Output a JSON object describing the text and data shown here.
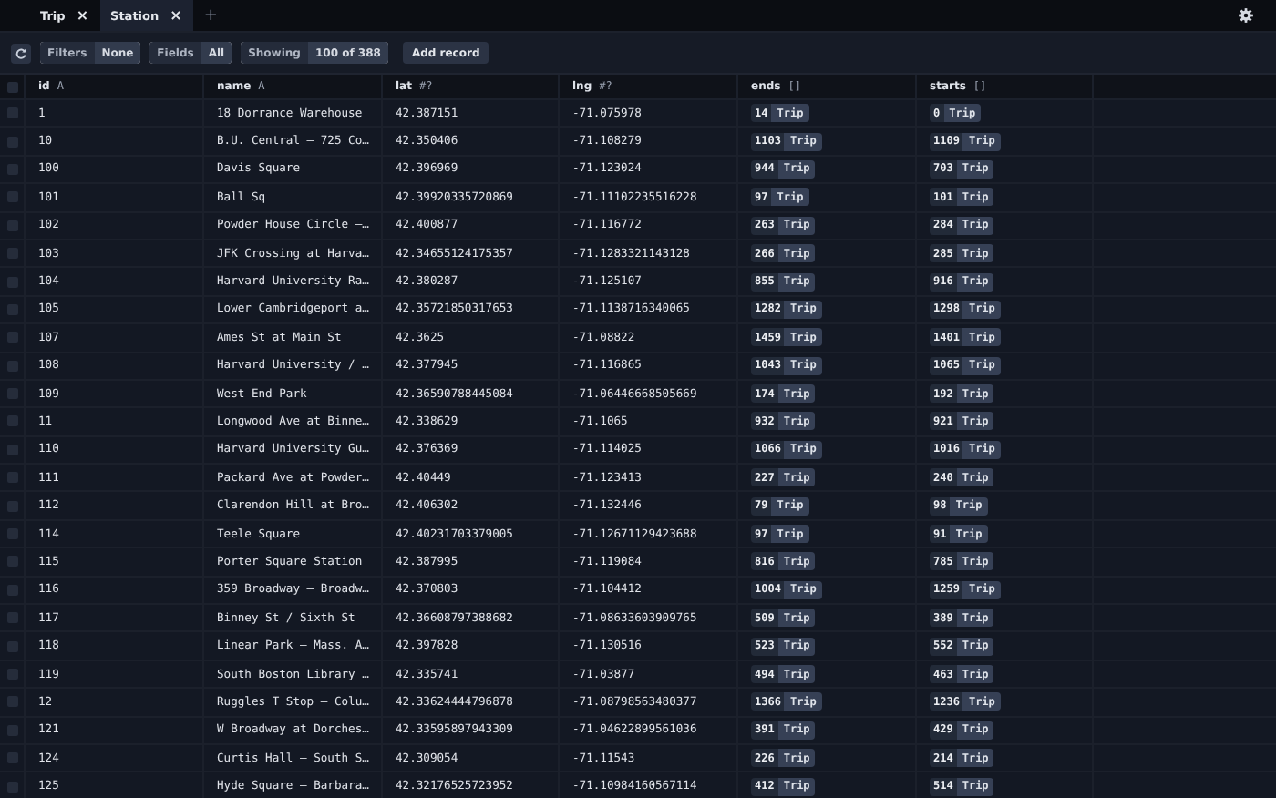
{
  "tabs": [
    {
      "label": "Trip",
      "close": "×",
      "selected": false
    },
    {
      "label": "Station",
      "close": "×",
      "selected": true
    }
  ],
  "new_tab": "+",
  "toolbar": {
    "filters": {
      "label": "Filters",
      "value": "None"
    },
    "fields": {
      "label": "Fields",
      "value": "All"
    },
    "showing": {
      "label": "Showing",
      "value": "100 of 388"
    },
    "add_record": "Add record"
  },
  "table": {
    "columns": [
      {
        "label": "id",
        "type": "A"
      },
      {
        "label": "name",
        "type": "A"
      },
      {
        "label": "lat",
        "type": "#?"
      },
      {
        "label": "lng",
        "type": "#?"
      },
      {
        "label": "ends",
        "type": "[]"
      },
      {
        "label": "starts",
        "type": "[]"
      }
    ],
    "header_checked": false,
    "rows": [
      {
        "checked": false,
        "id": "1",
        "name": "18 Dorrance Warehouse",
        "lat": "42.387151",
        "lng": "-71.075978",
        "ends": {
          "count": "14",
          "label": "Trip"
        },
        "starts": {
          "count": "0",
          "label": "Trip"
        }
      },
      {
        "checked": false,
        "id": "10",
        "name": "B.U. Central – 725 Co…",
        "lat": "42.350406",
        "lng": "-71.108279",
        "ends": {
          "count": "1103",
          "label": "Trip"
        },
        "starts": {
          "count": "1109",
          "label": "Trip"
        }
      },
      {
        "checked": false,
        "id": "100",
        "name": "Davis Square",
        "lat": "42.396969",
        "lng": "-71.123024",
        "ends": {
          "count": "944",
          "label": "Trip"
        },
        "starts": {
          "count": "703",
          "label": "Trip"
        }
      },
      {
        "checked": false,
        "id": "101",
        "name": "Ball Sq",
        "lat": "42.39920335720869",
        "lng": "-71.11102235516228",
        "ends": {
          "count": "97",
          "label": "Trip"
        },
        "starts": {
          "count": "101",
          "label": "Trip"
        }
      },
      {
        "checked": false,
        "id": "102",
        "name": "Powder House Circle –…",
        "lat": "42.400877",
        "lng": "-71.116772",
        "ends": {
          "count": "263",
          "label": "Trip"
        },
        "starts": {
          "count": "284",
          "label": "Trip"
        }
      },
      {
        "checked": false,
        "id": "103",
        "name": "JFK Crossing at Harva…",
        "lat": "42.34655124175357",
        "lng": "-71.1283321143128",
        "ends": {
          "count": "266",
          "label": "Trip"
        },
        "starts": {
          "count": "285",
          "label": "Trip"
        }
      },
      {
        "checked": false,
        "id": "104",
        "name": "Harvard University Ra…",
        "lat": "42.380287",
        "lng": "-71.125107",
        "ends": {
          "count": "855",
          "label": "Trip"
        },
        "starts": {
          "count": "916",
          "label": "Trip"
        }
      },
      {
        "checked": false,
        "id": "105",
        "name": "Lower Cambridgeport a…",
        "lat": "42.35721850317653",
        "lng": "-71.1138716340065",
        "ends": {
          "count": "1282",
          "label": "Trip"
        },
        "starts": {
          "count": "1298",
          "label": "Trip"
        }
      },
      {
        "checked": false,
        "id": "107",
        "name": "Ames St at Main St",
        "lat": "42.3625",
        "lng": "-71.08822",
        "ends": {
          "count": "1459",
          "label": "Trip"
        },
        "starts": {
          "count": "1401",
          "label": "Trip"
        }
      },
      {
        "checked": false,
        "id": "108",
        "name": "Harvard University / …",
        "lat": "42.377945",
        "lng": "-71.116865",
        "ends": {
          "count": "1043",
          "label": "Trip"
        },
        "starts": {
          "count": "1065",
          "label": "Trip"
        }
      },
      {
        "checked": false,
        "id": "109",
        "name": "West End Park",
        "lat": "42.36590788445084",
        "lng": "-71.06446668505669",
        "ends": {
          "count": "174",
          "label": "Trip"
        },
        "starts": {
          "count": "192",
          "label": "Trip"
        }
      },
      {
        "checked": false,
        "id": "11",
        "name": "Longwood Ave at Binne…",
        "lat": "42.338629",
        "lng": "-71.1065",
        "ends": {
          "count": "932",
          "label": "Trip"
        },
        "starts": {
          "count": "921",
          "label": "Trip"
        }
      },
      {
        "checked": false,
        "id": "110",
        "name": "Harvard University Gu…",
        "lat": "42.376369",
        "lng": "-71.114025",
        "ends": {
          "count": "1066",
          "label": "Trip"
        },
        "starts": {
          "count": "1016",
          "label": "Trip"
        }
      },
      {
        "checked": false,
        "id": "111",
        "name": "Packard Ave at Powder…",
        "lat": "42.40449",
        "lng": "-71.123413",
        "ends": {
          "count": "227",
          "label": "Trip"
        },
        "starts": {
          "count": "240",
          "label": "Trip"
        }
      },
      {
        "checked": false,
        "id": "112",
        "name": "Clarendon Hill at Bro…",
        "lat": "42.406302",
        "lng": "-71.132446",
        "ends": {
          "count": "79",
          "label": "Trip"
        },
        "starts": {
          "count": "98",
          "label": "Trip"
        }
      },
      {
        "checked": false,
        "id": "114",
        "name": "Teele Square",
        "lat": "42.40231703379005",
        "lng": "-71.12671129423688",
        "ends": {
          "count": "97",
          "label": "Trip"
        },
        "starts": {
          "count": "91",
          "label": "Trip"
        }
      },
      {
        "checked": false,
        "id": "115",
        "name": "Porter Square Station",
        "lat": "42.387995",
        "lng": "-71.119084",
        "ends": {
          "count": "816",
          "label": "Trip"
        },
        "starts": {
          "count": "785",
          "label": "Trip"
        }
      },
      {
        "checked": false,
        "id": "116",
        "name": "359 Broadway – Broadw…",
        "lat": "42.370803",
        "lng": "-71.104412",
        "ends": {
          "count": "1004",
          "label": "Trip"
        },
        "starts": {
          "count": "1259",
          "label": "Trip"
        }
      },
      {
        "checked": false,
        "id": "117",
        "name": "Binney St / Sixth St",
        "lat": "42.36608797388682",
        "lng": "-71.08633603909765",
        "ends": {
          "count": "509",
          "label": "Trip"
        },
        "starts": {
          "count": "389",
          "label": "Trip"
        }
      },
      {
        "checked": false,
        "id": "118",
        "name": "Linear Park – Mass. A…",
        "lat": "42.397828",
        "lng": "-71.130516",
        "ends": {
          "count": "523",
          "label": "Trip"
        },
        "starts": {
          "count": "552",
          "label": "Trip"
        }
      },
      {
        "checked": false,
        "id": "119",
        "name": "South Boston Library …",
        "lat": "42.335741",
        "lng": "-71.03877",
        "ends": {
          "count": "494",
          "label": "Trip"
        },
        "starts": {
          "count": "463",
          "label": "Trip"
        }
      },
      {
        "checked": false,
        "id": "12",
        "name": "Ruggles T Stop – Colu…",
        "lat": "42.33624444796878",
        "lng": "-71.08798563480377",
        "ends": {
          "count": "1366",
          "label": "Trip"
        },
        "starts": {
          "count": "1236",
          "label": "Trip"
        }
      },
      {
        "checked": false,
        "id": "121",
        "name": "W Broadway at Dorches…",
        "lat": "42.33595897943309",
        "lng": "-71.04622899561036",
        "ends": {
          "count": "391",
          "label": "Trip"
        },
        "starts": {
          "count": "429",
          "label": "Trip"
        }
      },
      {
        "checked": false,
        "id": "124",
        "name": "Curtis Hall – South S…",
        "lat": "42.309054",
        "lng": "-71.11543",
        "ends": {
          "count": "226",
          "label": "Trip"
        },
        "starts": {
          "count": "214",
          "label": "Trip"
        }
      },
      {
        "checked": false,
        "id": "125",
        "name": "Hyde Square – Barbara…",
        "lat": "42.32176525723952",
        "lng": "-71.10984160567114",
        "ends": {
          "count": "412",
          "label": "Trip"
        },
        "starts": {
          "count": "514",
          "label": "Trip"
        }
      }
    ]
  }
}
